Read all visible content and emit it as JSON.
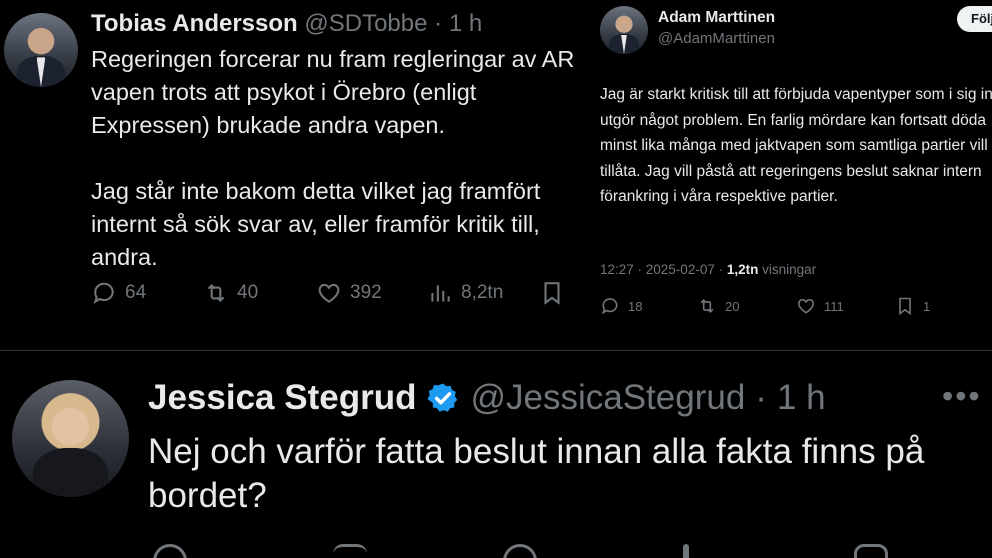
{
  "tweet1": {
    "name": "Tobias Andersson",
    "handle": "@SDTobbe",
    "separator": "·",
    "time": "1 h",
    "text": "Regeringen forcerar nu fram regleringar av AR vapen trots att psykot i Örebro (enligt Expressen) brukade andra vapen.\n\nJag står inte bakom detta vilket jag framfört internt så sök svar av, eller framför kritik till, andra.",
    "replies": "64",
    "reposts": "40",
    "likes": "392",
    "views": "8,2tn"
  },
  "tweet2": {
    "name": "Adam Marttinen",
    "handle": "@AdamMarttinen",
    "follow_label": "Följ",
    "text": "Jag är starkt kritisk till att förbjuda vapentyper som i sig inte utgör något problem. En farlig mördare kan fortsatt döda minst lika många med jaktvapen som samtliga partier vill tillåta. Jag vill påstå att regeringens beslut saknar intern förankring i våra respektive partier.",
    "timestamp": "12:27 · 2025-02-07 · ",
    "views_count": "1,2tn",
    "views_label": " visningar",
    "replies": "18",
    "reposts": "20",
    "likes": "111",
    "bookmarks": "1"
  },
  "tweet3": {
    "name": "Jessica Stegrud",
    "handle": "@JessicaStegrud",
    "separator": "·",
    "time": "1 h",
    "more": "•••",
    "text": "Nej och varför fatta beslut innan alla fakta finns på bordet?"
  },
  "colors": {
    "background": "#000000",
    "text": "#e7e9ea",
    "muted": "#71767b",
    "verified": "#1d9bf0"
  }
}
